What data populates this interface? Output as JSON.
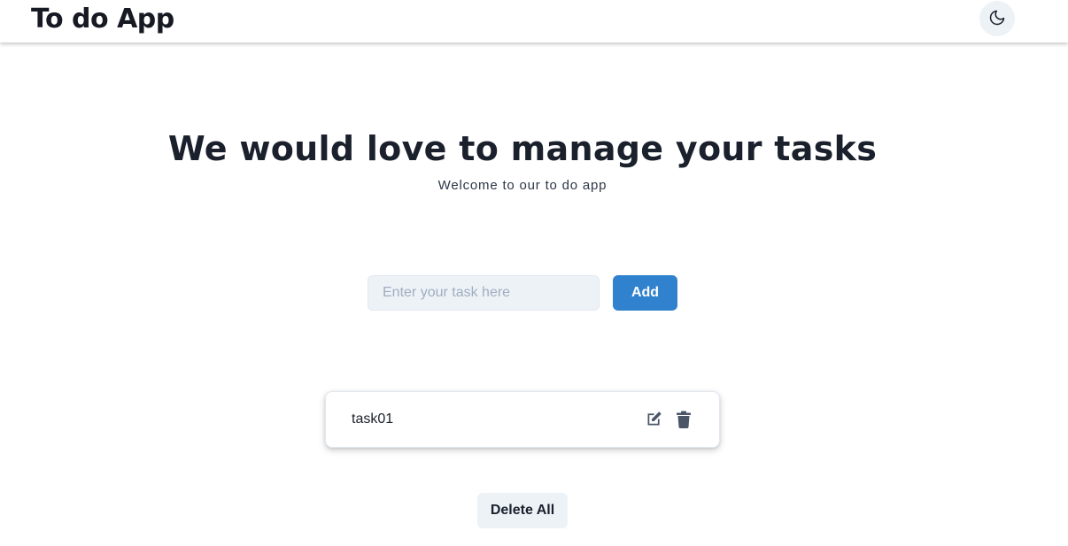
{
  "navbar": {
    "brand": "To do App",
    "theme_toggle_icon": "moon-icon"
  },
  "hero": {
    "title": "We would love to manage your tasks",
    "subtitle": "Welcome to our to do app"
  },
  "task_form": {
    "input_placeholder": "Enter your task here",
    "input_value": "",
    "add_label": "Add"
  },
  "tasks": [
    {
      "text": "task01",
      "edit_icon": "edit-icon",
      "delete_icon": "trash-icon"
    }
  ],
  "delete_all_label": "Delete All",
  "colors": {
    "accent": "#3182ce",
    "icon": "#4a5568",
    "muted_bg": "#edf2f7"
  }
}
